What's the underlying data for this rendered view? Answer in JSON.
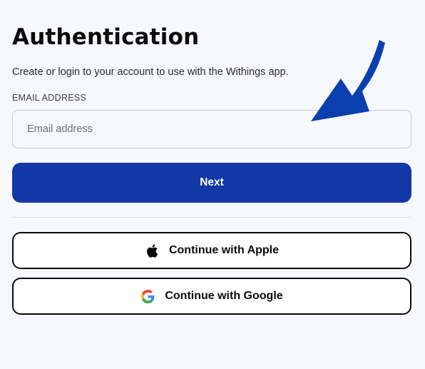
{
  "auth": {
    "title": "Authentication",
    "subtitle": "Create or login to your account to use with the Withings app.",
    "email_label": "EMAIL ADDRESS",
    "email_placeholder": "Email address",
    "email_value": "",
    "next_label": "Next",
    "apple_label": "Continue with Apple",
    "google_label": "Continue with Google"
  },
  "icons": {
    "apple": "apple-icon",
    "google": "google-icon",
    "annotation_arrow": "arrow-pointer-icon"
  },
  "colors": {
    "background": "#f7f8fc",
    "primary_button": "#1438a6",
    "arrow": "#0a3fb0",
    "text": "#0b0b0b",
    "input_border": "#c9cbd1"
  }
}
